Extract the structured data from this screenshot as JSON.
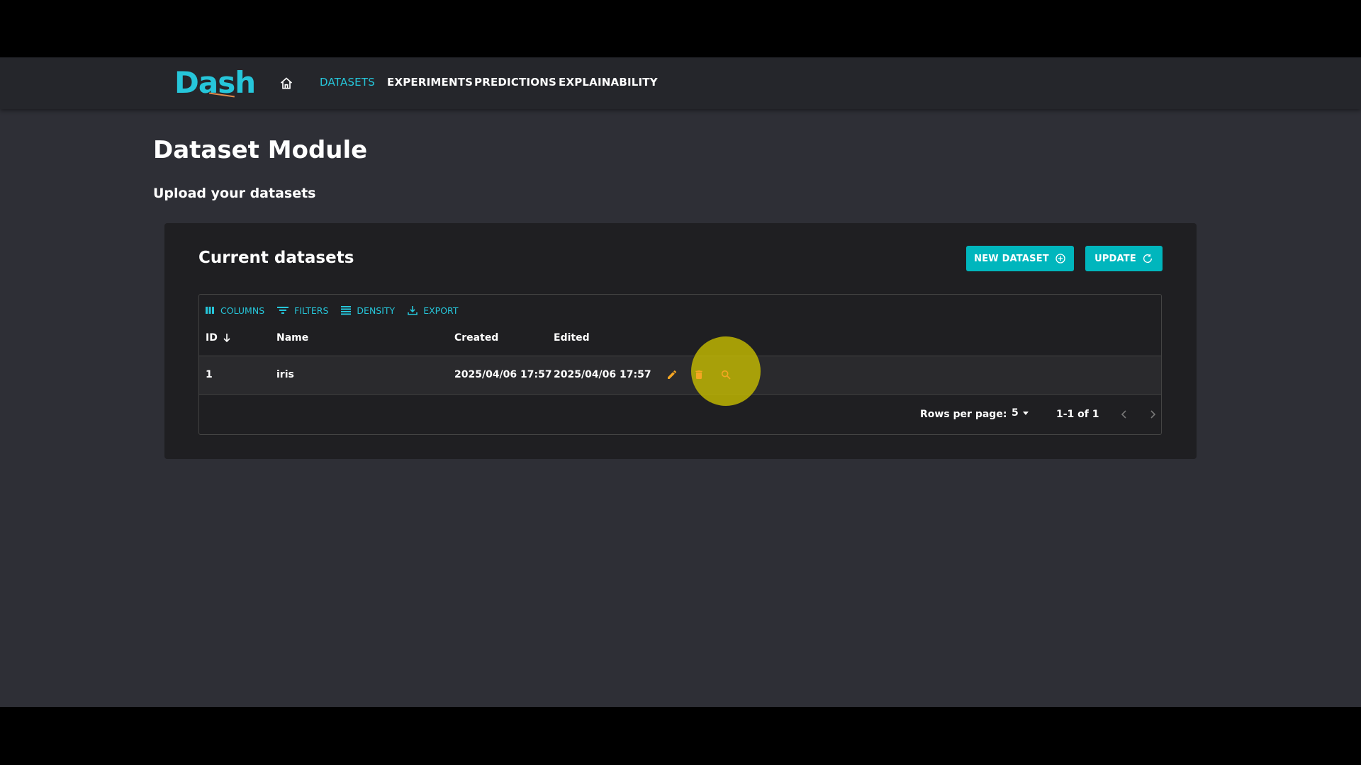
{
  "nav": {
    "logo_text": "Dash",
    "links": [
      "DATASETS",
      "EXPERIMENTS",
      "PREDICTIONS",
      "EXPLAINABILITY"
    ],
    "active": "DATASETS",
    "home_icon": "home-icon"
  },
  "page": {
    "title": "Dataset Module",
    "subtitle": "Upload your datasets"
  },
  "card": {
    "title": "Current datasets",
    "new_button": "NEW DATASET",
    "update_button": "UPDATE"
  },
  "grid": {
    "toolbar": [
      "COLUMNS",
      "FILTERS",
      "DENSITY",
      "EXPORT"
    ],
    "columns": [
      "ID",
      "Name",
      "Created",
      "Edited"
    ],
    "sort_column": "ID",
    "rows": [
      {
        "id": "1",
        "name": "iris",
        "created": "2025/04/06 17:57",
        "edited": "2025/04/06 17:57"
      }
    ],
    "footer": {
      "rows_per_page_label": "Rows per page:",
      "rows_per_page_value": "5",
      "page_info": "1-1 of 1"
    }
  },
  "colors": {
    "accent": "#26c6da",
    "button": "#00b6bd",
    "edit_icon": "#f5a623",
    "delete_icon": "#f5a623",
    "highlight": "#c8be00"
  }
}
